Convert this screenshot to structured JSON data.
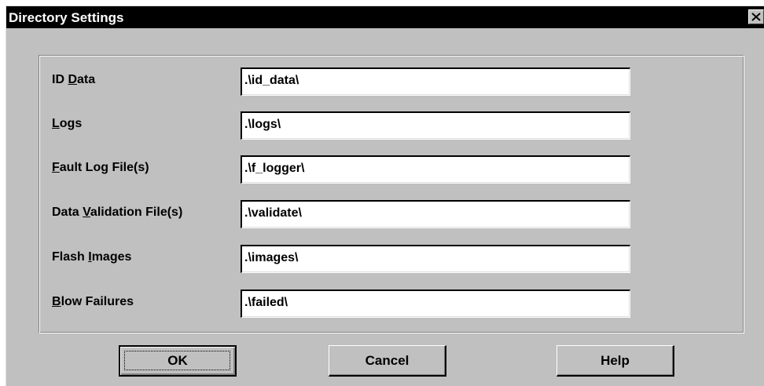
{
  "window": {
    "title": "Directory Settings",
    "close_icon": "close-icon"
  },
  "fields": [
    {
      "label_before": "ID ",
      "mnemonic": "D",
      "label_after": "ata",
      "value": ".\\id_data\\"
    },
    {
      "label_before": "",
      "mnemonic": "L",
      "label_after": "ogs",
      "value": ".\\logs\\"
    },
    {
      "label_before": "",
      "mnemonic": "F",
      "label_after": "ault Log File(s)",
      "value": ".\\f_logger\\"
    },
    {
      "label_before": "Data ",
      "mnemonic": "V",
      "label_after": "alidation File(s)",
      "value": ".\\validate\\"
    },
    {
      "label_before": "Flash ",
      "mnemonic": "I",
      "label_after": "mages",
      "value": ".\\images\\"
    },
    {
      "label_before": "",
      "mnemonic": "B",
      "label_after": "low Failures",
      "value": ".\\failed\\"
    }
  ],
  "buttons": {
    "ok": "OK",
    "cancel": "Cancel",
    "help": "Help"
  },
  "colors": {
    "titlebar": "#000000",
    "face": "#c0c0c0",
    "field_bg": "#ffffff"
  }
}
